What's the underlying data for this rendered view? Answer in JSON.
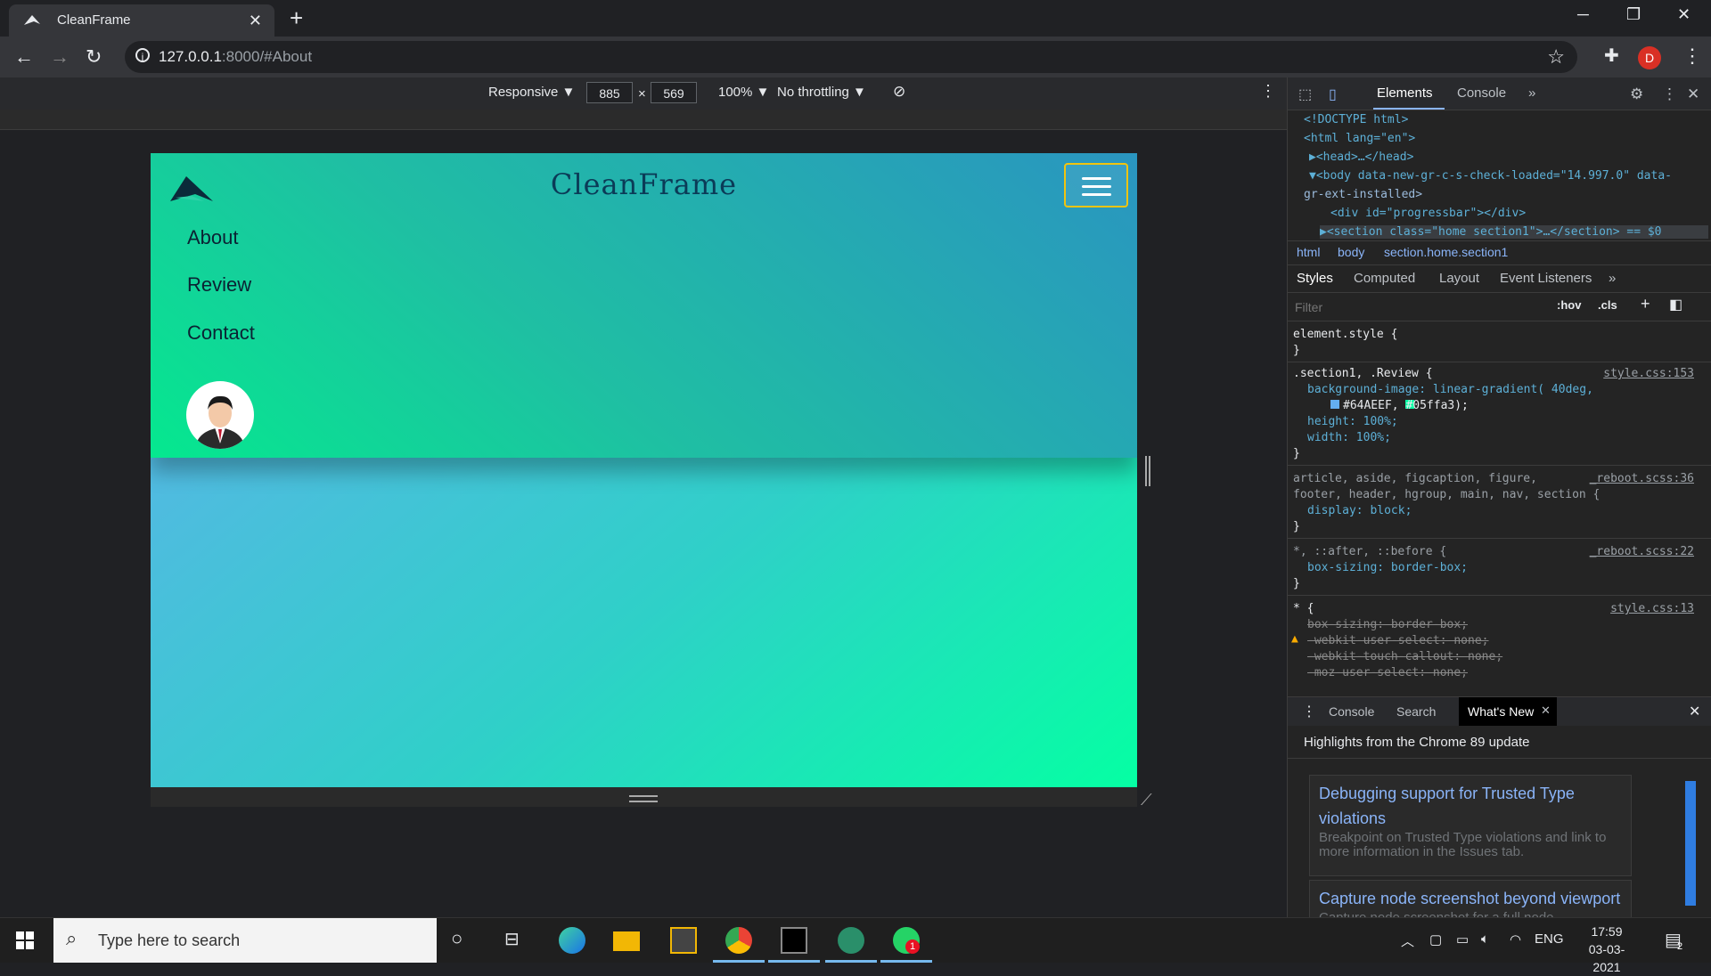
{
  "browser": {
    "tab_title": "CleanFrame",
    "tab_close": "✕",
    "new_tab": "+",
    "url_host": "127.0.0.1",
    "url_path": ":8000/#About",
    "profile_initial": "D"
  },
  "device_toolbar": {
    "mode": "Responsive ▼",
    "width": "885",
    "times": "×",
    "height": "569",
    "zoom": "100% ▼",
    "throttling": "No throttling ▼"
  },
  "site": {
    "brand": "CleanFrame",
    "nav": [
      "About",
      "Review",
      "Contact"
    ],
    "colors": {
      "gradient_start": "#64AEEF",
      "gradient_end": "#05ffa3",
      "menu_border": "#f1c40f"
    }
  },
  "devtools": {
    "tabs": [
      "Elements",
      "Console",
      "»"
    ],
    "dom": {
      "doctype": "<!DOCTYPE html>",
      "html_open": "<html lang=\"en\">",
      "head": "▶<head>…</head>",
      "body_open": "▼<body data-new-gr-c-s-check-loaded=\"14.997.0\" data-",
      "body_cont": "gr-ext-installed>",
      "progress": "<div id=\"progressbar\"></div>",
      "section": "▶<section class=\"home section1\">…</section> == $0"
    },
    "breadcrumbs": [
      "html",
      "body",
      "section.home.section1"
    ],
    "subtabs": [
      "Styles",
      "Computed",
      "Layout",
      "Event Listeners",
      "»"
    ],
    "filter_placeholder": "Filter",
    "hov": ":hov",
    "cls": ".cls",
    "styles": {
      "element_style": "element.style {",
      "close": "}",
      "rule1_selector": ".section1, .Review {",
      "rule1_src": "style.css:153",
      "rule1_bg": "background-image: linear-gradient( 40deg,",
      "rule1_bg2": "#64AEEF,  #05ffa3);",
      "rule1_h": "height: 100%;",
      "rule1_w": "width: 100%;",
      "rule2_selector": "article, aside, figcaption, figure,",
      "rule2_selector2": "footer, header, hgroup, main, nav, section {",
      "rule2_src": "_reboot.scss:36",
      "rule2_display": "display: block;",
      "rule3_selector": "*, ::after, ::before {",
      "rule3_src": "_reboot.scss:22",
      "rule3_box": "box-sizing: border-box;",
      "rule4_selector": "* {",
      "rule4_src": "style.css:13",
      "rule4_l1": "box-sizing: border-box;",
      "rule4_l2": "-webkit-user-select: none;",
      "rule4_l3": "-webkit-touch-callout: none;",
      "rule4_l4": "-moz-user-select: none;"
    },
    "drawer_tabs": [
      "Console",
      "Search",
      "What's New"
    ],
    "whatsnew_heading": "Highlights from the Chrome 89 update",
    "cards": [
      {
        "title": "Debugging support for Trusted Type violations",
        "desc": "Breakpoint on Trusted Type violations and link to more information in the Issues tab."
      },
      {
        "title": "Capture node screenshot beyond viewport",
        "desc": "Capture node screenshot for a full node"
      }
    ]
  },
  "taskbar": {
    "search_placeholder": "Type here to search",
    "lang": "ENG",
    "time": "17:59",
    "date": "03-03-2021",
    "notif_count": "2",
    "whatsapp_badge": "1"
  }
}
